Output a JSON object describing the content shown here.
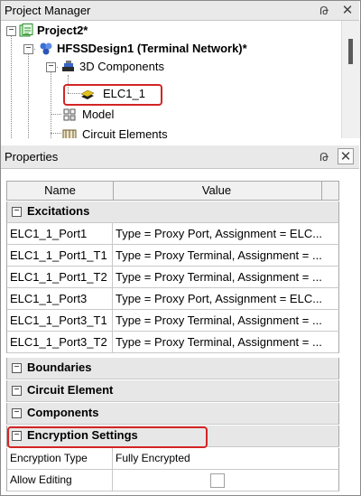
{
  "project_manager": {
    "title": "Project Manager",
    "pin_glyph": "Թ",
    "close_glyph": "✕",
    "tree": {
      "project": "Project2*",
      "design": "HFSSDesign1 (Terminal Network)*",
      "components_folder": "3D Components",
      "component_item": "ELC1_1",
      "model": "Model",
      "circuit_elements": "Circuit Elements"
    }
  },
  "properties": {
    "title": "Properties",
    "pin_glyph": "Թ",
    "close_glyph": "✕",
    "columns": {
      "name": "Name",
      "value": "Value"
    },
    "sections": {
      "excitations": "Excitations",
      "boundaries": "Boundaries",
      "circuit_element": "Circuit Element",
      "components": "Components",
      "encryption_settings": "Encryption Settings"
    },
    "excitation_rows": [
      {
        "name": "ELC1_1_Port1",
        "value": "Type = Proxy Port, Assignment = ELC..."
      },
      {
        "name": "ELC1_1_Port1_T1",
        "value": "Type = Proxy Terminal, Assignment = ..."
      },
      {
        "name": "ELC1_1_Port1_T2",
        "value": "Type = Proxy Terminal, Assignment = ..."
      },
      {
        "name": "ELC1_1_Port3",
        "value": "Type = Proxy Port, Assignment = ELC..."
      },
      {
        "name": "ELC1_1_Port3_T1",
        "value": "Type = Proxy Terminal, Assignment = ..."
      },
      {
        "name": "ELC1_1_Port3_T2",
        "value": "Type = Proxy Terminal, Assignment = ..."
      }
    ],
    "encryption_rows": [
      {
        "name": "Encryption Type",
        "value": "Fully Encrypted"
      },
      {
        "name": "Allow Editing",
        "checked": false
      }
    ]
  },
  "icons": {
    "expand_glyph": "−",
    "collapse_glyph": "−"
  },
  "colors": {
    "highlight": "#d32525",
    "section_bg": "#e7e7e7",
    "header_bg": "#e9e9e9"
  }
}
